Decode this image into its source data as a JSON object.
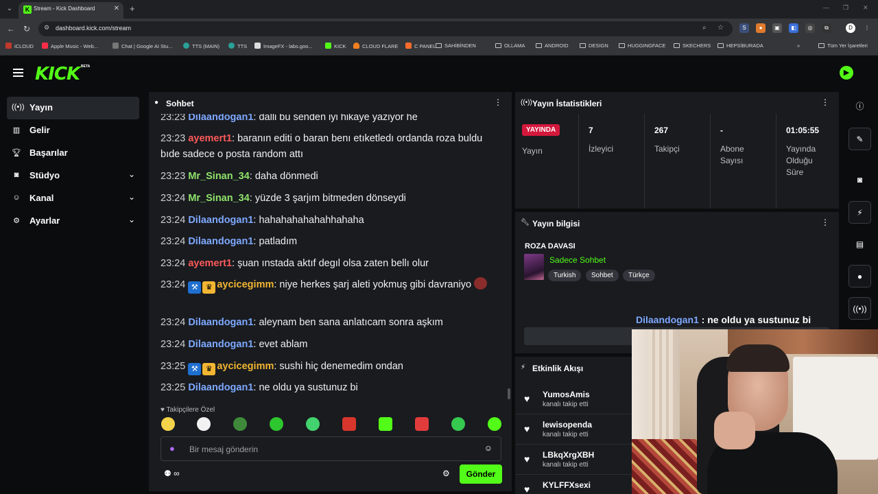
{
  "browser": {
    "tab_title": "Stream - Kick Dashboard",
    "url": "dashboard.kick.com/stream",
    "bookmarks": [
      "iCLOUD",
      "Apple Music - Web...",
      "Chat | Google AI Stu...",
      "TTS (MAIN)",
      "TTS",
      "ImageFX - labs.goo...",
      "KICK",
      "CLOUD FLARE",
      "C PANEL",
      "SAHİBİNDEN",
      "OLLAMA",
      "ANDROID",
      "DESIGN",
      "HUGGINGFACE",
      "SKECHERS",
      "HEPSİBURADA"
    ],
    "all_bookmarks": "Tüm Yer İşaretleri"
  },
  "brand": {
    "logo": "KICK",
    "beta": "BETA",
    "accent": "#53fc18"
  },
  "sidebar": {
    "items": [
      {
        "label": "Yayın"
      },
      {
        "label": "Gelir"
      },
      {
        "label": "Başarılar"
      },
      {
        "label": "Stüdyo"
      },
      {
        "label": "Kanal"
      },
      {
        "label": "Ayarlar"
      }
    ]
  },
  "chat": {
    "title": "Sohbet",
    "messages": [
      {
        "time": "23:23",
        "user": "Dilaandogan1",
        "text": "dalli bu senden iyi hikaye yaziyor he",
        "color": "#7ea8ff"
      },
      {
        "time": "23:23",
        "user": "ayemert1",
        "text": "baranın editi o baran benı etıketledı ordanda roza buldu bıde sadece o posta random attı",
        "color": "#ff5a5a"
      },
      {
        "time": "23:23",
        "user": "Mr_Sinan_34",
        "text": "daha dönmedi",
        "color": "#90e36b"
      },
      {
        "time": "23:24",
        "user": "Mr_Sinan_34",
        "text": "yüzde 3 şarjım bitmeden dönseydi",
        "color": "#90e36b"
      },
      {
        "time": "23:24",
        "user": "Dilaandogan1",
        "text": "hahahahahahahhahaha",
        "color": "#7ea8ff"
      },
      {
        "time": "23:24",
        "user": "Dilaandogan1",
        "text": "patladım",
        "color": "#7ea8ff"
      },
      {
        "time": "23:24",
        "user": "ayemert1",
        "text": "şuan ınstada aktıf degıl olsa zaten bellı olur",
        "color": "#ff5a5a"
      },
      {
        "time": "23:24",
        "user": "aycicegimm",
        "text": "niye herkes şarj aleti yokmuş gibi davraniyo",
        "color": "#f2b632"
      },
      {
        "time": "23:24",
        "user": "Dilaandogan1",
        "text": "aleynam ben sana anlatıcam sonra aşkım",
        "color": "#7ea8ff"
      },
      {
        "time": "23:24",
        "user": "Dilaandogan1",
        "text": "evet ablam",
        "color": "#7ea8ff"
      },
      {
        "time": "23:25",
        "user": "aycicegimm",
        "text": "sushi hiç denemedim ondan",
        "color": "#f2b632"
      },
      {
        "time": "23:25",
        "user": "Dilaandogan1",
        "text": "ne oldu ya sustunuz bi",
        "color": "#7ea8ff"
      }
    ],
    "emotes_label": "Takipçilere Özel",
    "input_placeholder": "Bir mesaj gönderin",
    "send_label": "Gönder",
    "footer_left": "∞"
  },
  "stats": {
    "title": "Yayın İstatistikleri",
    "live_badge": "YAYINDA",
    "live_label": "Yayın",
    "items": [
      {
        "value": "7",
        "label": "İzleyici"
      },
      {
        "value": "267",
        "label": "Takipçi"
      },
      {
        "value": "-",
        "label": "Abone Sayısı"
      },
      {
        "value": "01:05:55",
        "label": "Yayında Olduğu Süre"
      }
    ],
    "live_color": "#d4183c"
  },
  "stream_info": {
    "title": "Yayın bilgisi",
    "stream_title": "ROZA DAVASI",
    "category": "Sadece Sohbet",
    "tags": [
      "Turkish",
      "Sohbet",
      "Türkçe"
    ]
  },
  "overlay": {
    "user": "Dilaandogan1",
    "text": " : ne oldu ya sustunuz bi"
  },
  "activity": {
    "title": "Etkinlik Akışı",
    "items": [
      {
        "name": "YumosAmis",
        "desc": "kanalı takip etti"
      },
      {
        "name": "lewisopenda",
        "desc": "kanalı takip etti"
      },
      {
        "name": "LBkqXrgXBH",
        "desc": "kanalı takip etti"
      },
      {
        "name": "KYLFFXsexi",
        "desc": ""
      }
    ]
  }
}
